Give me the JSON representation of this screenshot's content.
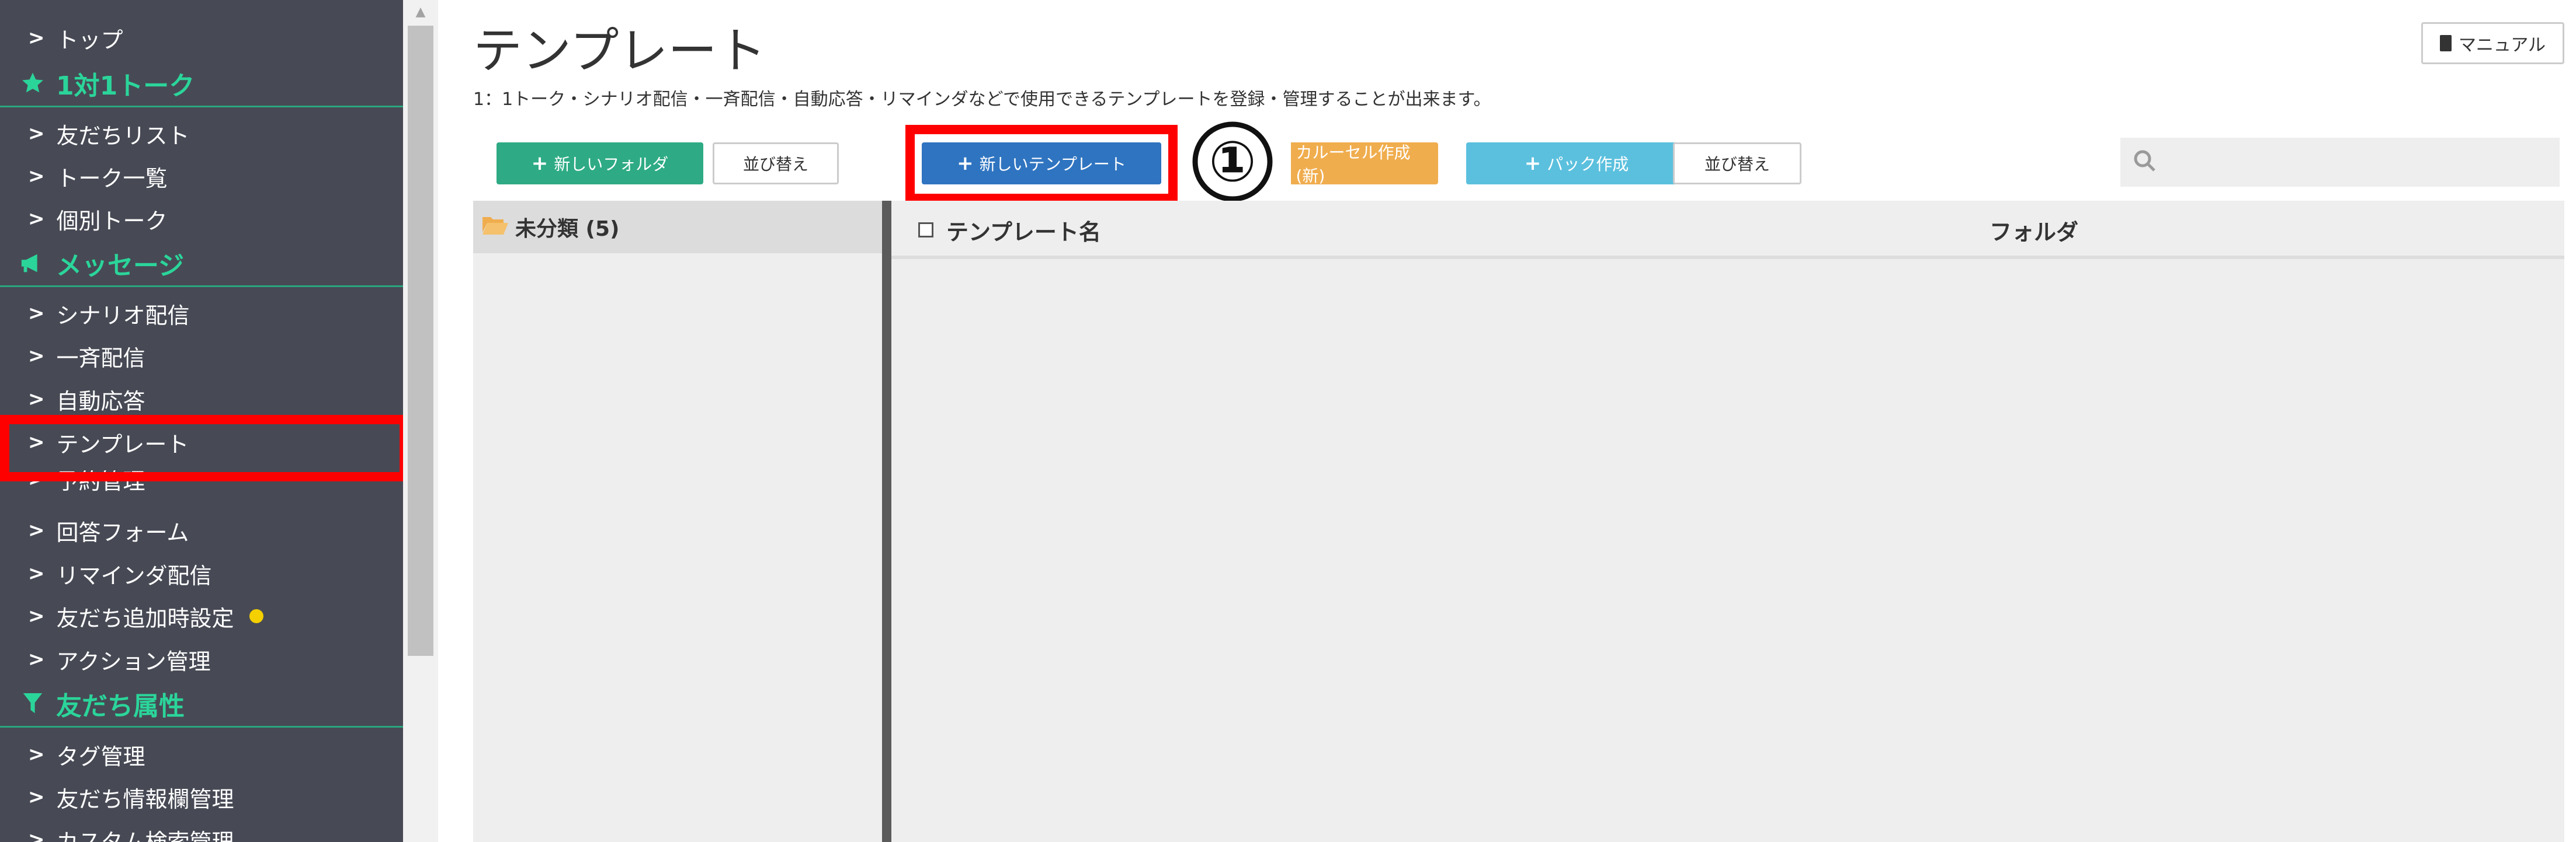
{
  "sidebar": {
    "items": [
      {
        "type": "item",
        "label": "トップ"
      },
      {
        "type": "head",
        "label": "1対1トーク",
        "icon": "star-icon"
      },
      {
        "type": "item",
        "label": "友だちリスト"
      },
      {
        "type": "item",
        "label": "トーク一覧"
      },
      {
        "type": "item",
        "label": "個別トーク"
      },
      {
        "type": "head",
        "label": "メッセージ",
        "icon": "megaphone-icon"
      },
      {
        "type": "item",
        "label": "シナリオ配信"
      },
      {
        "type": "item",
        "label": "一斉配信"
      },
      {
        "type": "item",
        "label": "自動応答"
      },
      {
        "type": "item",
        "label": "テンプレート",
        "selected": true
      },
      {
        "type": "item",
        "label": "予約管理",
        "partially_hidden": true
      },
      {
        "type": "item",
        "label": "回答フォーム"
      },
      {
        "type": "item",
        "label": "リマインダ配信"
      },
      {
        "type": "item",
        "label": "友だち追加時設定",
        "badge": "dot"
      },
      {
        "type": "item",
        "label": "アクション管理"
      },
      {
        "type": "head",
        "label": "友だち属性",
        "icon": "filter-icon"
      },
      {
        "type": "item",
        "label": "タグ管理"
      },
      {
        "type": "item",
        "label": "友だち情報欄管理"
      },
      {
        "type": "item",
        "label": "カスタム検索管理"
      }
    ],
    "accent_color": "#2bd59a",
    "background_color": "#474a55"
  },
  "header": {
    "title": "テンプレート",
    "description": "1：1トーク・シナリオ配信・一斉配信・自動応答・リマインダなどで使用できるテンプレートを登録・管理することが出来ます。",
    "manual_label": "マニュアル"
  },
  "toolbar": {
    "new_folder_label": "新しいフォルダ",
    "sort_label_left": "並び替え",
    "new_template_label": "新しいテンプレート",
    "carousel_label": "カルーセル作成(新)",
    "pack_label": "パック作成",
    "sort_label_right": "並び替え",
    "step_marker": "①",
    "search_value": ""
  },
  "folders": [
    {
      "label": "未分類 (5)"
    }
  ],
  "table": {
    "columns": [
      "テンプレート名",
      "フォルダ"
    ]
  },
  "colors": {
    "highlight": "#ff0000",
    "primary_button": "#2f74c0",
    "green_button": "#2eab84",
    "orange_button": "#f0ad4e",
    "cyan_button": "#5bc0de"
  }
}
